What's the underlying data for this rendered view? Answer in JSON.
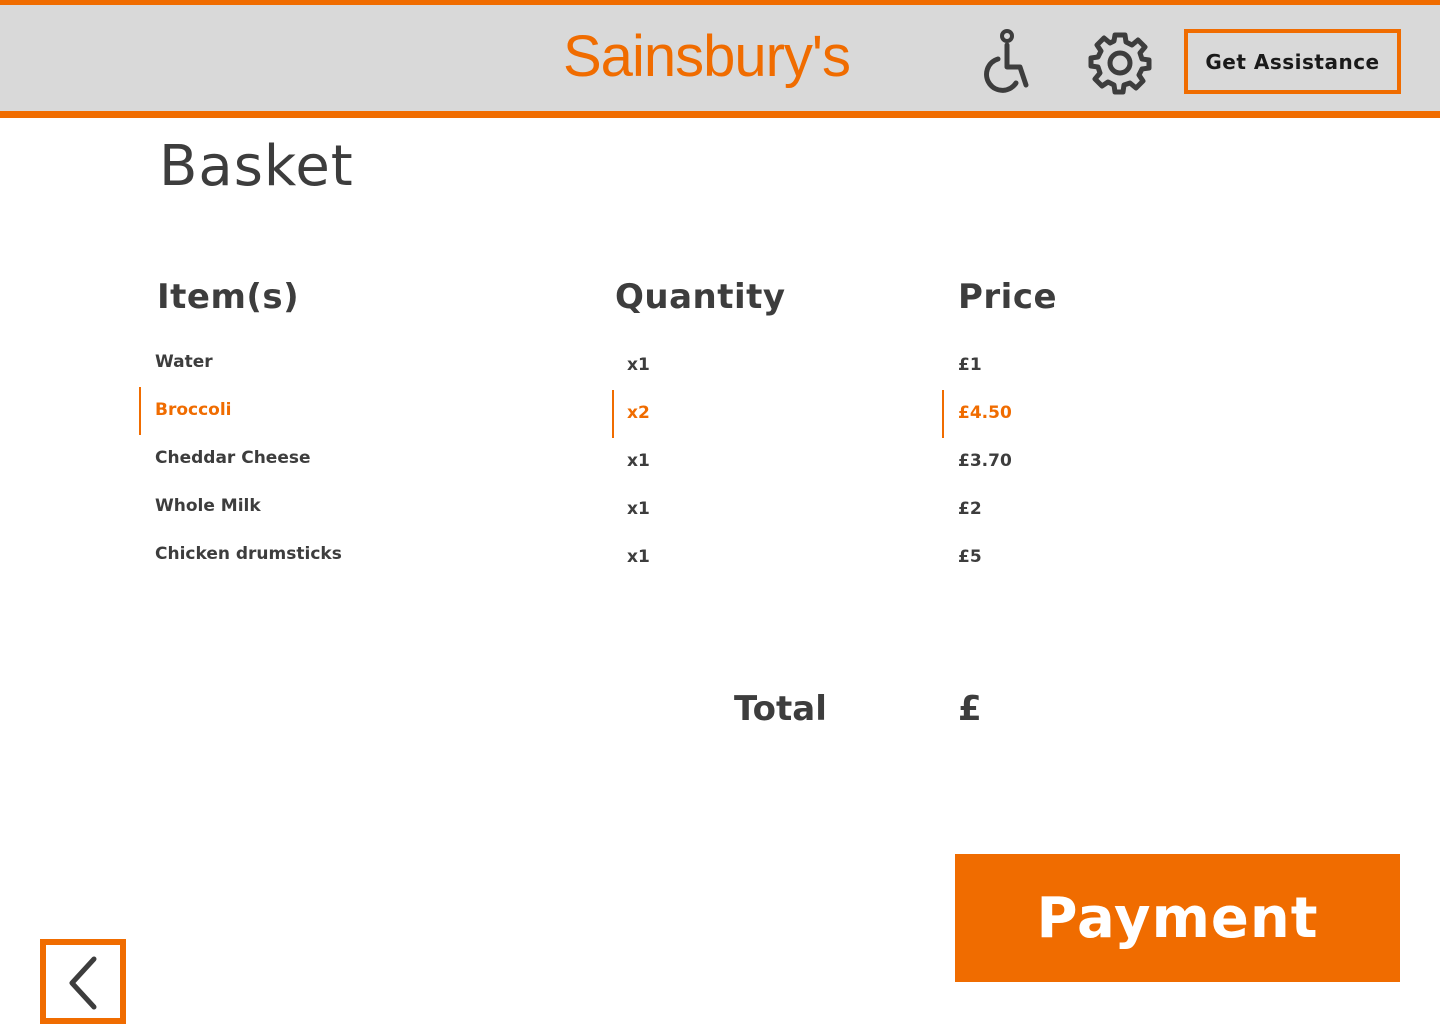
{
  "header": {
    "brand": "Sainsbury's",
    "accessibility_icon": "accessibility-wheelchair-icon",
    "settings_icon": "gear-icon",
    "assist_label": "Get Assistance"
  },
  "page": {
    "title": "Basket"
  },
  "table": {
    "headers": {
      "item": "Item(s)",
      "quantity": "Quantity",
      "price": "Price"
    },
    "rows": [
      {
        "item": "Water",
        "quantity": "x1",
        "price": "£1",
        "selected": false
      },
      {
        "item": "Broccoli",
        "quantity": "x2",
        "price": "£4.50",
        "selected": true
      },
      {
        "item": "Cheddar Cheese",
        "quantity": "x1",
        "price": "£3.70",
        "selected": false
      },
      {
        "item": "Whole Milk",
        "quantity": "x1",
        "price": "£2",
        "selected": false
      },
      {
        "item": "Chicken drumsticks",
        "quantity": "x1",
        "price": "£5",
        "selected": false
      }
    ]
  },
  "summary": {
    "total_label": "Total",
    "total_value": "£"
  },
  "actions": {
    "payment_label": "Payment",
    "back_icon": "chevron-left-icon"
  },
  "colors": {
    "accent": "#f06c00",
    "header_bg": "#d9d9d9",
    "text": "#3d3d3d"
  }
}
